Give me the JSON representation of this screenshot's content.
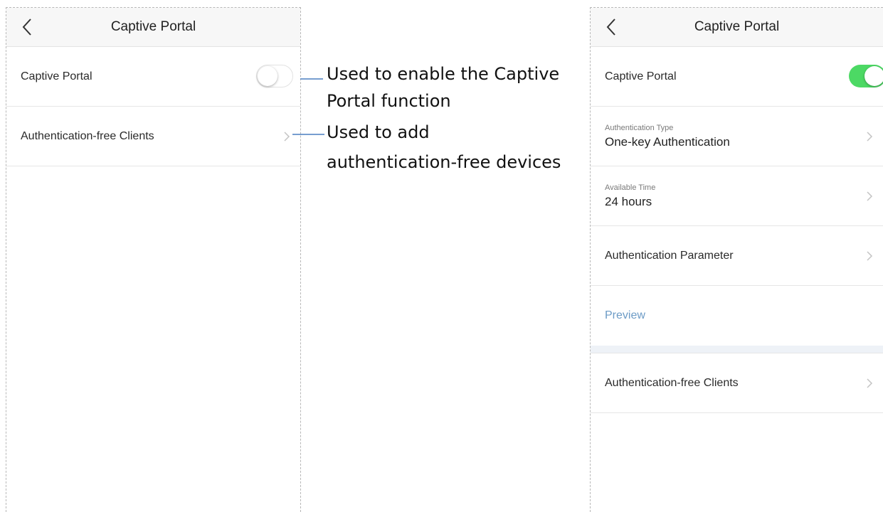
{
  "left_screen": {
    "nav": {
      "title": "Captive Portal",
      "back_icon": "chevron-left-icon"
    },
    "rows": {
      "captive_portal": {
        "label": "Captive Portal",
        "toggle_state": "off"
      },
      "auth_free_clients": {
        "label": "Authentication-free Clients"
      }
    }
  },
  "annotations": {
    "toggle_note": {
      "line1": "Used to enable the Captive",
      "line2": "Portal function"
    },
    "clients_note": {
      "line1": "Used to add",
      "line2": "authentication-free devices"
    }
  },
  "right_screen": {
    "nav": {
      "title": "Captive Portal",
      "back_icon": "chevron-left-icon"
    },
    "rows": {
      "captive_portal": {
        "label": "Captive Portal",
        "toggle_state": "on"
      },
      "auth_type": {
        "label": "Authentication Type",
        "value": "One-key Authentication"
      },
      "available_time": {
        "label": "Available Time",
        "value": "24 hours"
      },
      "auth_parameter": {
        "label": "Authentication Parameter"
      },
      "preview": {
        "label": "Preview"
      },
      "auth_free_clients": {
        "label": "Authentication-free Clients"
      }
    }
  },
  "colors": {
    "toggle_on": "#4cd964",
    "link": "#6c9bc6",
    "annotation_line": "#4a7fc0"
  }
}
